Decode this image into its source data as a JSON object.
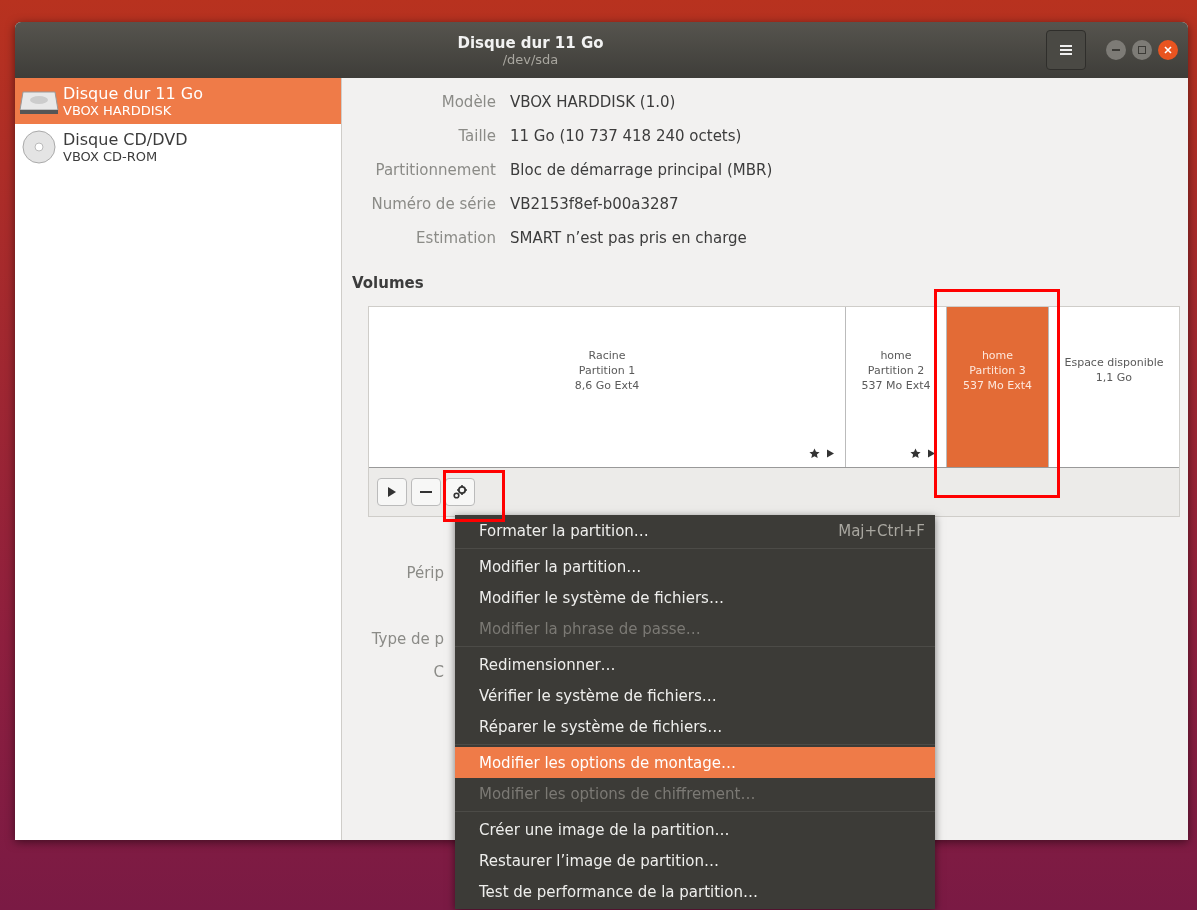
{
  "window": {
    "title": "Disque dur 11 Go",
    "subtitle": "/dev/sda"
  },
  "sidebar": {
    "items": [
      {
        "kind": "harddisk",
        "name": "Disque dur 11 Go",
        "detail": "VBOX HARDDISK",
        "selected": true
      },
      {
        "kind": "optical",
        "name": "Disque CD/DVD",
        "detail": "VBOX CD-ROM",
        "selected": false
      }
    ]
  },
  "drive_info": [
    {
      "label": "Modèle",
      "value": "VBOX HARDDISK (1.0)"
    },
    {
      "label": "Taille",
      "value": "11 Go (10 737 418 240 octets)"
    },
    {
      "label": "Partitionnement",
      "value": "Bloc de démarrage principal (MBR)"
    },
    {
      "label": "Numéro de série",
      "value": "VB2153f8ef-b00a3287"
    },
    {
      "label": "Estimation",
      "value": "SMART n’est pas pris en charge"
    }
  ],
  "volumes": {
    "heading": "Volumes",
    "partitions": [
      {
        "lines": [
          "Racine",
          "Partition 1",
          "8,6 Go Ext4"
        ],
        "selected": false,
        "markers": true
      },
      {
        "lines": [
          "home",
          "Partition 2",
          "537 Mo Ext4"
        ],
        "selected": false,
        "markers": true
      },
      {
        "lines": [
          "home",
          "Partition 3",
          "537 Mo Ext4"
        ],
        "selected": true,
        "markers": false
      },
      {
        "lines": [
          "Espace disponible",
          "1,1 Go"
        ],
        "selected": false,
        "markers": false
      }
    ]
  },
  "volume_details": [
    {
      "label": "Périp"
    },
    {
      "label": "Type de p"
    },
    {
      "label": "C"
    }
  ],
  "menu": {
    "groups": [
      [
        {
          "label": "Formater la partition…",
          "shortcut": "Maj+Ctrl+F",
          "disabled": false,
          "selected": false
        }
      ],
      [
        {
          "label": "Modifier la partition…",
          "disabled": false,
          "selected": false
        },
        {
          "label": "Modifier le système de fichiers…",
          "disabled": false,
          "selected": false
        },
        {
          "label": "Modifier la phrase de passe…",
          "disabled": true,
          "selected": false
        }
      ],
      [
        {
          "label": "Redimensionner…",
          "disabled": false,
          "selected": false
        },
        {
          "label": "Vérifier le système de fichiers…",
          "disabled": false,
          "selected": false
        },
        {
          "label": "Réparer le système de fichiers…",
          "disabled": false,
          "selected": false
        }
      ],
      [
        {
          "label": "Modifier les options de montage…",
          "disabled": false,
          "selected": true
        },
        {
          "label": "Modifier les options de chiffrement…",
          "disabled": true,
          "selected": false
        }
      ],
      [
        {
          "label": "Créer une image de la partition…",
          "disabled": false,
          "selected": false
        },
        {
          "label": "Restaurer l’image de partition…",
          "disabled": false,
          "selected": false
        },
        {
          "label": "Test de performance de la partition…",
          "disabled": false,
          "selected": false
        }
      ]
    ]
  }
}
